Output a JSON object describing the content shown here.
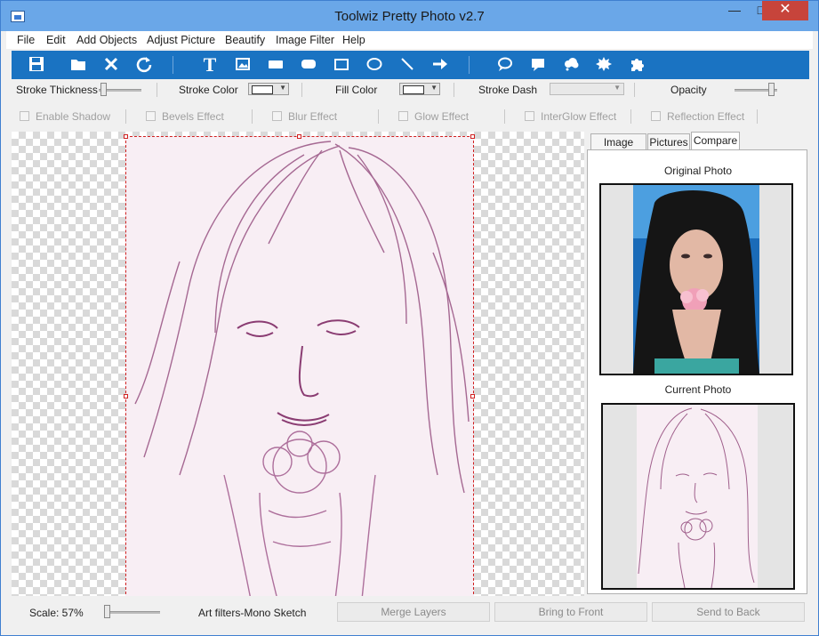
{
  "window": {
    "title": "Toolwiz Pretty Photo v2.7",
    "minimize_glyph": "—",
    "maximize_glyph": "□",
    "close_glyph": "✕"
  },
  "menu": [
    "File",
    "Edit",
    "Add Objects",
    "Adjust Picture",
    "Beautify",
    "Image Filter",
    "Help"
  ],
  "toolbar": {
    "icons": [
      "save-icon",
      "open-folder-icon",
      "delete-icon",
      "refresh-icon",
      "text-icon",
      "picture-icon",
      "rectangle-icon",
      "rounded-rectangle-icon",
      "square-outline-icon",
      "ellipse-icon",
      "line-icon",
      "arrow-icon",
      "speech-bubble-icon",
      "callout-icon",
      "cloud-icon",
      "starburst-icon",
      "puzzle-icon"
    ],
    "text_glyph": "T"
  },
  "properties": {
    "stroke_thickness_label": "Stroke Thickness",
    "stroke_color_label": "Stroke Color",
    "fill_color_label": "Fill Color",
    "stroke_dash_label": "Stroke Dash",
    "opacity_label": "Opacity",
    "effects": [
      "Enable Shadow",
      "Bevels Effect",
      "Blur Effect",
      "Glow Effect",
      "InterGlow Effect",
      "Reflection Effect"
    ]
  },
  "tabs": [
    "Image Filter",
    "Pictures",
    "Compare"
  ],
  "active_tab": "Compare",
  "compare": {
    "original_label": "Original Photo",
    "current_label": "Current Photo"
  },
  "status": {
    "scale_text": "Scale: 57%",
    "filter_text": "Art filters-Mono Sketch",
    "merge_button": "Merge Layers",
    "front_button": "Bring to Front",
    "back_button": "Send to Back"
  },
  "colors": {
    "titlebar": "#6aa7e8",
    "toolbar": "#1a73c2",
    "sketch_tone": "#8a3c72",
    "close_button": "#c7443b"
  }
}
